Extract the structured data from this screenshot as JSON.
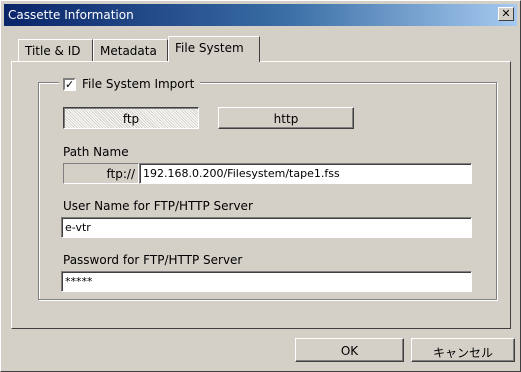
{
  "window": {
    "title": "Cassette Information",
    "close_glyph": "✕"
  },
  "tabs": [
    {
      "label": "Title & ID",
      "active": false
    },
    {
      "label": "Metadata",
      "active": false
    },
    {
      "label": "File System",
      "active": true
    }
  ],
  "file_system": {
    "import_label": "File System Import",
    "import_checked": true,
    "check_glyph": "✓",
    "protocol_buttons": {
      "ftp": "ftp",
      "http": "http",
      "selected": "ftp"
    },
    "path": {
      "label": "Path Name",
      "prefix": "ftp://",
      "value": "192.168.0.200/Filesystem/tape1.fss"
    },
    "user": {
      "label": "User Name for FTP/HTTP Server",
      "value": "e-vtr"
    },
    "password": {
      "label": "Password for FTP/HTTP Server",
      "value": "*****"
    }
  },
  "footer": {
    "ok_label": "OK",
    "cancel_label": "キャンセル"
  },
  "icons": {
    "close": "close-icon",
    "checkbox": "check-icon"
  }
}
